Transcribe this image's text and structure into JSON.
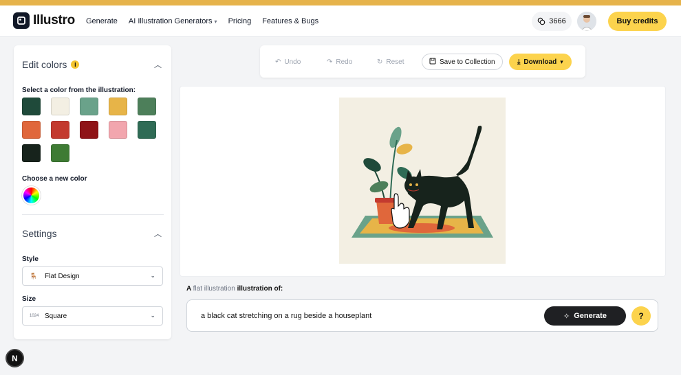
{
  "brand": {
    "name": "Illustro"
  },
  "nav": {
    "generate": "Generate",
    "ai_generators": "AI Illustration Generators",
    "pricing": "Pricing",
    "features": "Features & Bugs"
  },
  "header": {
    "credits": "3666",
    "buy_label": "Buy credits"
  },
  "edit_colors": {
    "title": "Edit colors",
    "info": "i",
    "select_label": "Select a color from the illustration:",
    "swatches": [
      "#1f4a3a",
      "#f3efe3",
      "#6aa28a",
      "#e7b448",
      "#4d7f5a",
      "#e0673b",
      "#c33a2f",
      "#8f1317",
      "#f2a6ae",
      "#2f6b55",
      "#17231c",
      "#3e7b34"
    ],
    "new_color_label": "Choose a new color"
  },
  "settings": {
    "title": "Settings",
    "style_label": "Style",
    "style_value": "Flat Design",
    "size_label": "Size",
    "size_icon": "1024",
    "size_value": "Square"
  },
  "toolbar": {
    "undo": "Undo",
    "redo": "Redo",
    "reset": "Reset",
    "save": "Save to Collection",
    "download": "Download"
  },
  "prompt": {
    "prefix": "A",
    "style_word": "flat illustration",
    "suffix": "illustration of:",
    "text": "a black cat stretching on a rug beside a houseplant",
    "generate_label": "Generate",
    "help": "?"
  },
  "badge": "N",
  "colors": {
    "accent": "#fcd34d",
    "dark": "#1f2023"
  }
}
